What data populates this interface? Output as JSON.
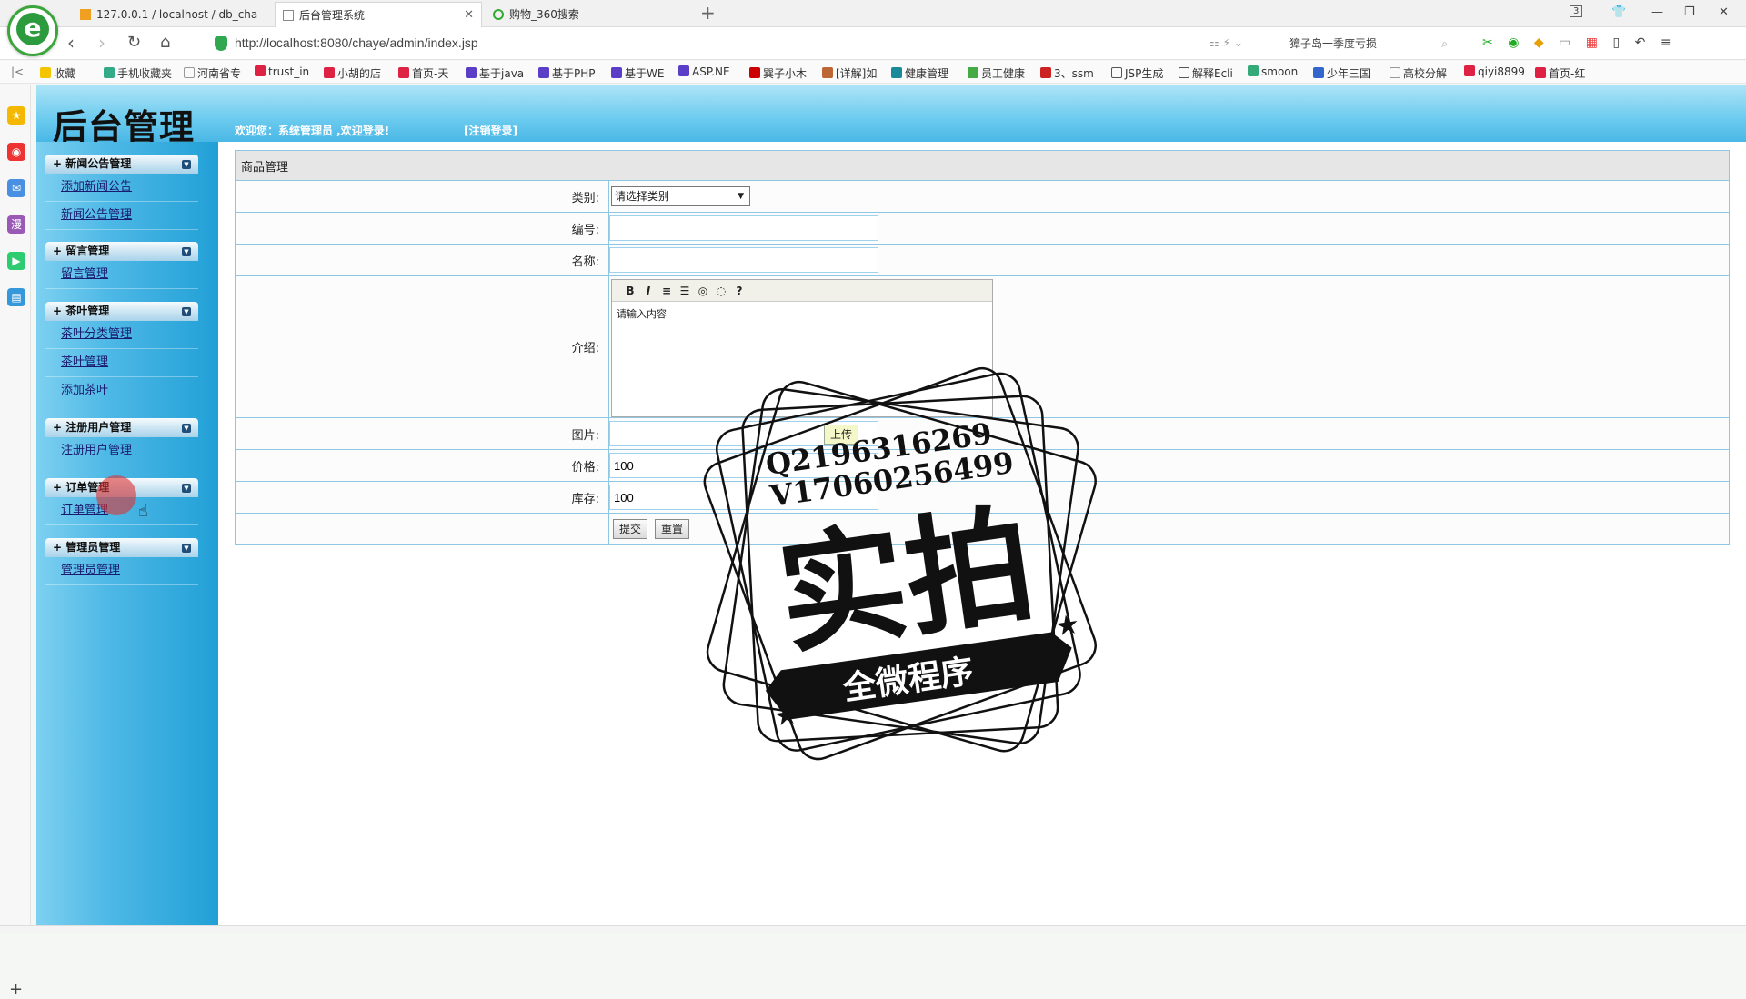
{
  "browser": {
    "tabs": [
      {
        "label": "127.0.0.1 / localhost / db_cha"
      },
      {
        "label": "后台管理系统"
      },
      {
        "label": "购物_360搜索"
      }
    ],
    "tab_count": "3",
    "url": "http://localhost:8080/chaye/admin/index.jsp",
    "search_text": "獐子岛一季度亏损",
    "bookmarks": [
      "收藏",
      "手机收藏夹",
      "河南省专",
      "trust_in",
      "小胡的店",
      "首页-天",
      "基于java",
      "基于PHP",
      "基于WE",
      "ASP.NE",
      "巽子小木",
      "[详解]如",
      "健康管理",
      "员工健康",
      "3、ssm",
      "JSP生成",
      "解释Ecli",
      "smoon",
      "少年三国",
      "高校分解",
      "qiyi8899",
      "首页-红"
    ]
  },
  "header": {
    "title": "后台管理",
    "welcome": "欢迎您：系统管理员  ,欢迎登录!",
    "logout": "[注销登录]"
  },
  "menu": {
    "groups": [
      {
        "title": "+ 新闻公告管理",
        "items": [
          "添加新闻公告",
          "新闻公告管理"
        ]
      },
      {
        "title": "+ 留言管理",
        "items": [
          "留言管理"
        ]
      },
      {
        "title": "+ 茶叶管理",
        "items": [
          "茶叶分类管理",
          "茶叶管理",
          "添加茶叶"
        ]
      },
      {
        "title": "+ 注册用户管理",
        "items": [
          "注册用户管理"
        ]
      },
      {
        "title": "+ 订单管理",
        "items": [
          "订单管理"
        ]
      },
      {
        "title": "+ 管理员管理",
        "items": [
          "管理员管理"
        ]
      }
    ]
  },
  "form": {
    "title": "商品管理",
    "category_label": "类别:",
    "category_value": "请选择类别",
    "code_label": "编号:",
    "code_value": "",
    "name_label": "名称:",
    "name_value": "",
    "intro_label": "介绍:",
    "intro_placeholder": "请输入内容",
    "image_label": "图片:",
    "upload_label": "上传",
    "price_label": "价格:",
    "price_value": "100",
    "stock_label": "库存:",
    "stock_value": "100",
    "submit_label": "提交",
    "reset_label": "重置"
  },
  "watermark": {
    "line1": "Q2196316269",
    "line2": "V17060256499",
    "main": "实拍",
    "sub": "全微程序"
  },
  "colors": {
    "header_blue": "#6ccbef",
    "menu_blue": "#21a0d6",
    "table_border": "#8ec7e2"
  }
}
